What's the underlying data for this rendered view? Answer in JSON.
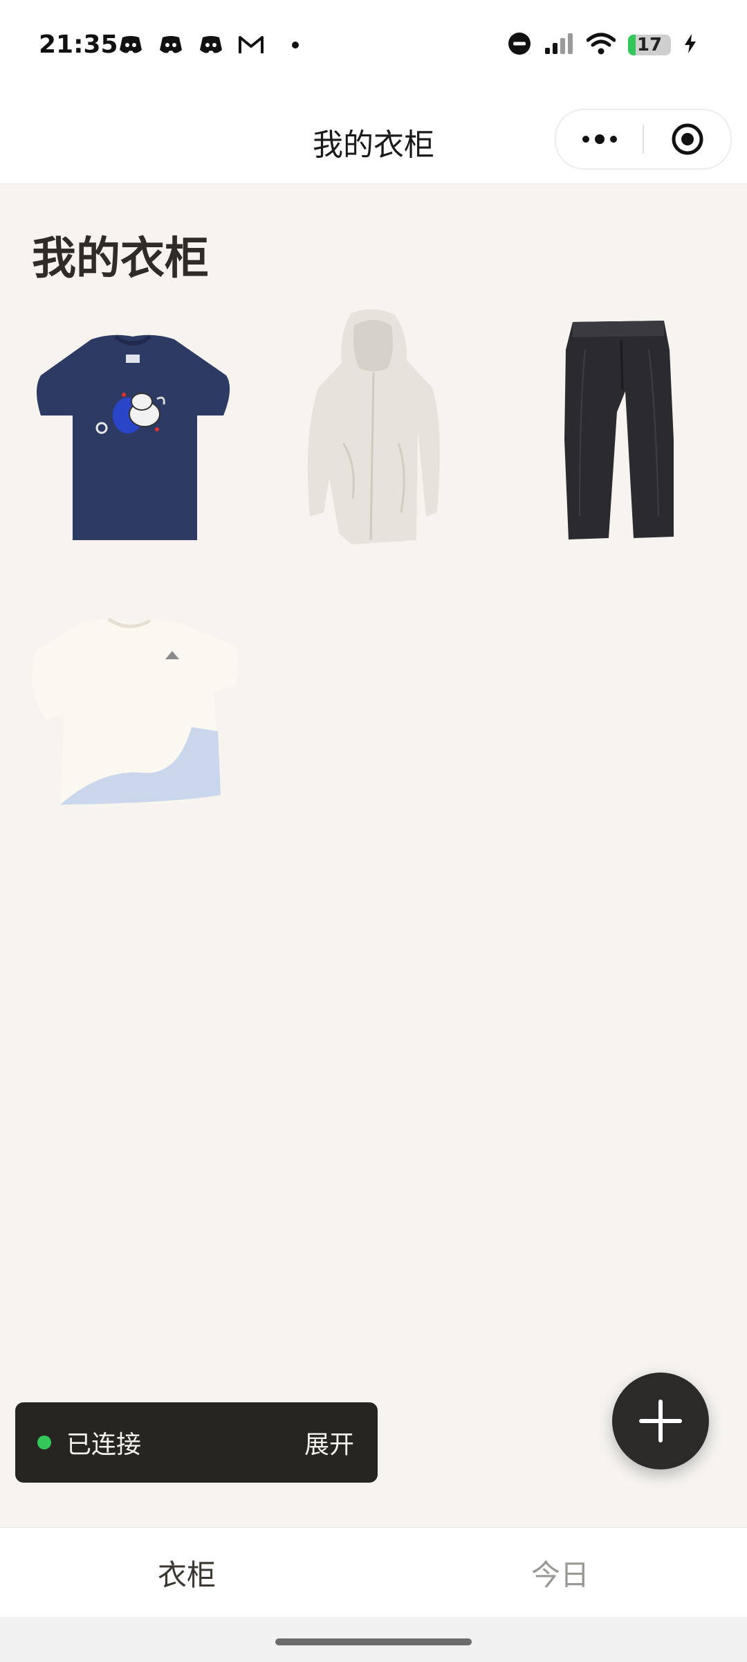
{
  "status_bar": {
    "time": "21:35",
    "notification_icons": [
      "discord-icon",
      "discord-icon",
      "discord-icon",
      "gmail-icon"
    ],
    "battery_level": "17",
    "battery_fraction": 0.17
  },
  "nav": {
    "title": "我的衣柜"
  },
  "page": {
    "heading": "我的衣柜"
  },
  "wardrobe": {
    "items": [
      {
        "kind": "navy-tshirt",
        "color": "#2d3a64"
      },
      {
        "kind": "light-hoodie",
        "color": "#e6e3dc"
      },
      {
        "kind": "dark-pants",
        "color": "#2b2a2e"
      },
      {
        "kind": "white-tshirt",
        "color": "#fbf8f1"
      }
    ]
  },
  "connection": {
    "status_label": "已连接",
    "expand_label": "展开",
    "status_color": "#34c759"
  },
  "tabs": [
    {
      "label": "衣柜",
      "active": true
    },
    {
      "label": "今日",
      "active": false
    }
  ]
}
